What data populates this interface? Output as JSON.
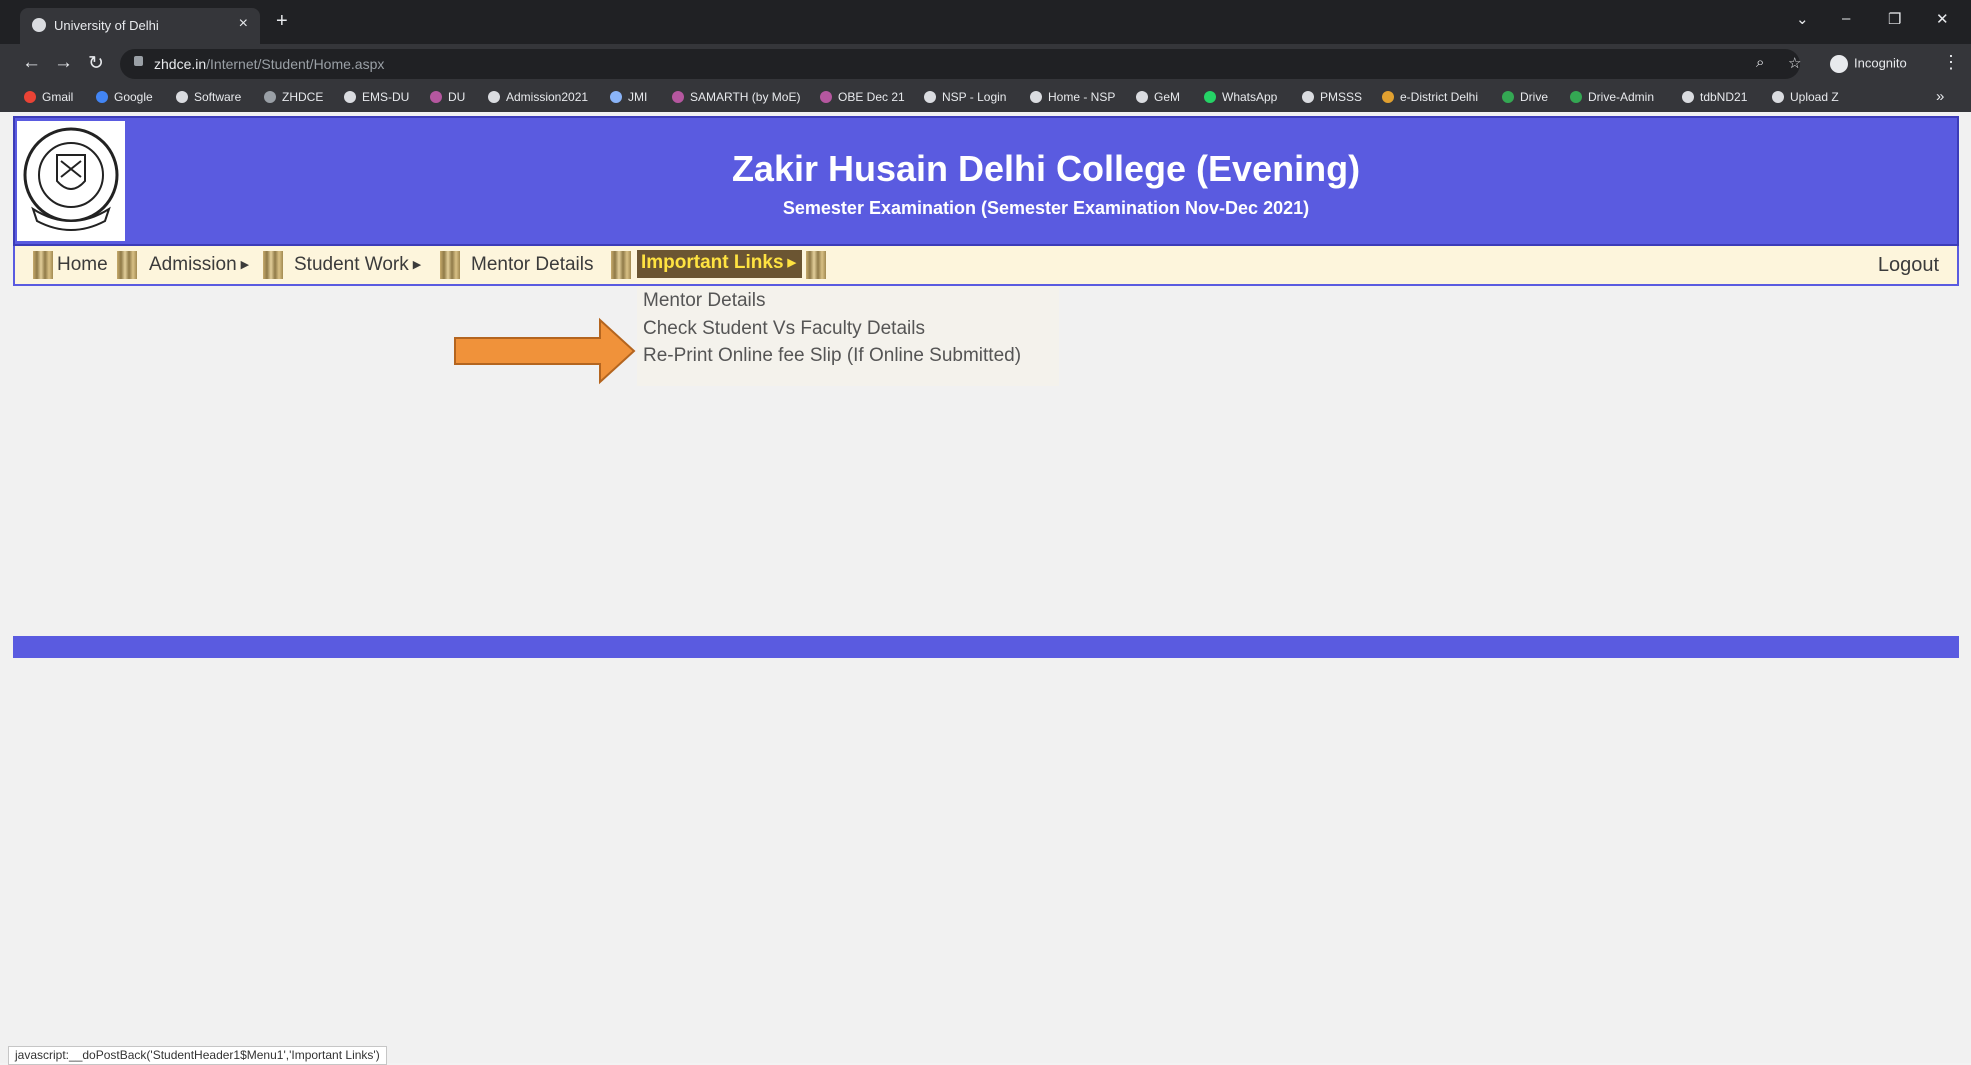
{
  "browser": {
    "tab_title": "University of Delhi",
    "url_host": "zhdce.in",
    "url_path": "/Internet/Student/Home.aspx",
    "profile_label": "Incognito",
    "status_text": "javascript:__doPostBack('StudentHeader1$Menu1','Important Links')"
  },
  "bookmarks": [
    {
      "label": "Gmail",
      "color": "#ea4335"
    },
    {
      "label": "Google",
      "color": "#4285f4"
    },
    {
      "label": "Software",
      "color": "#dadce0"
    },
    {
      "label": "ZHDCE",
      "color": "#9aa0a6"
    },
    {
      "label": "EMS-DU",
      "color": "#dadce0"
    },
    {
      "label": "DU",
      "color": "#b5579f"
    },
    {
      "label": "Admission2021",
      "color": "#dadce0"
    },
    {
      "label": "JMI",
      "color": "#8ab4f8"
    },
    {
      "label": "SAMARTH (by MoE)",
      "color": "#b5579f"
    },
    {
      "label": "OBE Dec 21",
      "color": "#b5579f"
    },
    {
      "label": "NSP - Login",
      "color": "#dadce0"
    },
    {
      "label": "Home - NSP",
      "color": "#dadce0"
    },
    {
      "label": "GeM",
      "color": "#dadce0"
    },
    {
      "label": "WhatsApp",
      "color": "#25d366"
    },
    {
      "label": "PMSSS",
      "color": "#dadce0"
    },
    {
      "label": "e-District Delhi",
      "color": "#e0a030"
    },
    {
      "label": "Drive",
      "color": "#34a853"
    },
    {
      "label": "Drive-Admin",
      "color": "#34a853"
    },
    {
      "label": "tdbND21",
      "color": "#dadce0"
    },
    {
      "label": "Upload Z",
      "color": "#dadce0"
    }
  ],
  "site": {
    "college_name": "Zakir Husain Delhi College (Evening)",
    "subtitle": "Semester Examination (Semester Examination Nov-Dec 2021)",
    "colors": {
      "header": "#5a5be0",
      "menu_bg": "#fdf5dc",
      "highlight_text": "#ffe341",
      "arrow": "#f0923a"
    }
  },
  "menu": {
    "home": "Home",
    "admission": "Admission",
    "student_work": "Student Work",
    "mentor_details": "Mentor Details",
    "important_links": "Important Links",
    "logout": "Logout"
  },
  "dropdown": {
    "items": [
      "Mentor Details",
      "Check Student Vs Faculty Details",
      "Re-Print Online fee Slip (If Online Submitted)"
    ]
  }
}
